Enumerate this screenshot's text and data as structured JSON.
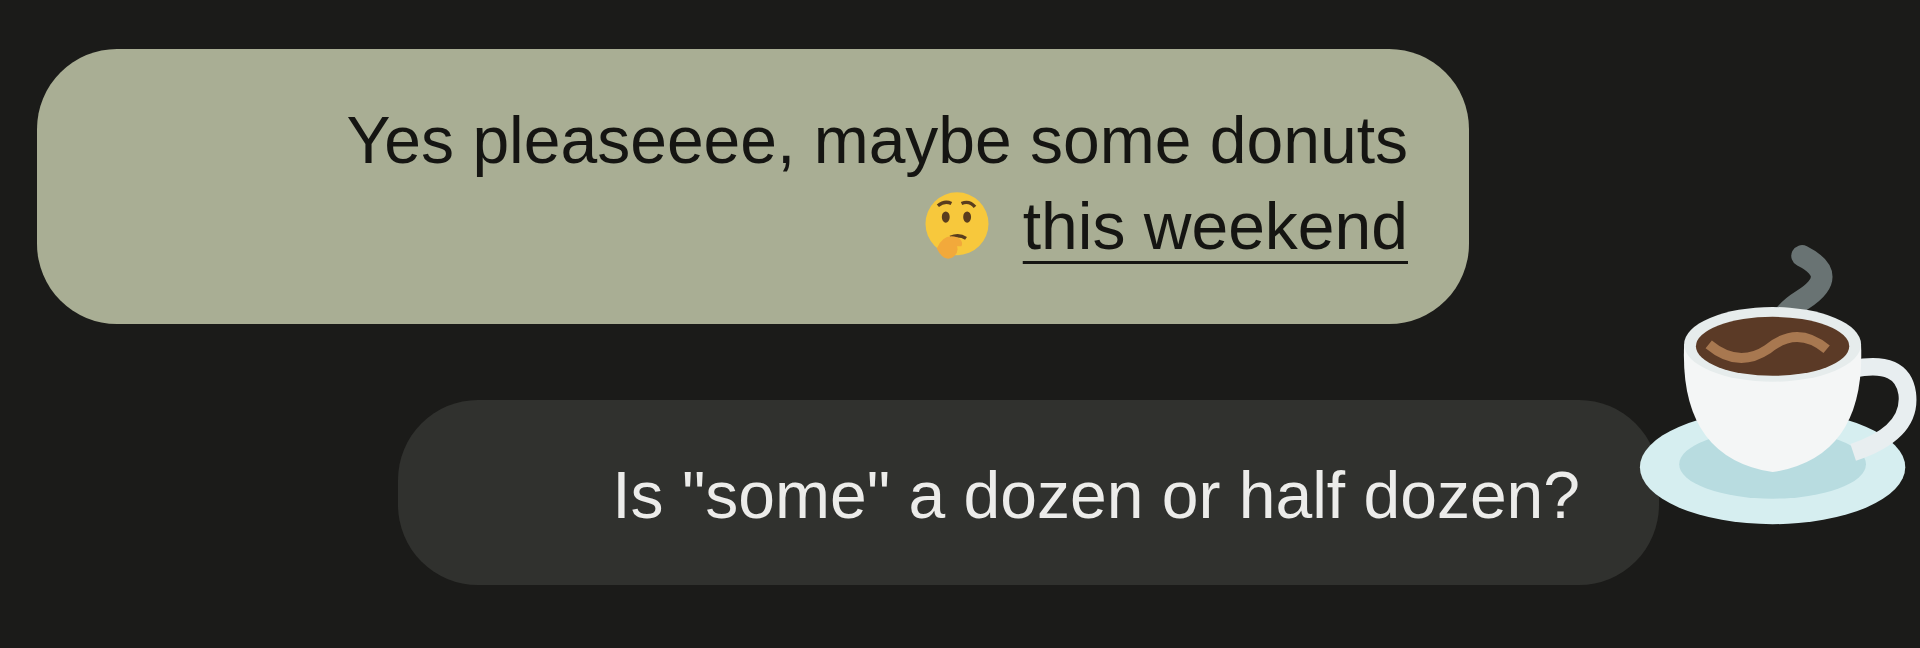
{
  "messages": [
    {
      "kind": "received",
      "text": "Yes pleaseeee, maybe some donuts",
      "link": "this weekend",
      "trailing_icon": true
    },
    {
      "kind": "sent",
      "text": "Is \"some\" a dozen or half dozen?"
    }
  ]
}
